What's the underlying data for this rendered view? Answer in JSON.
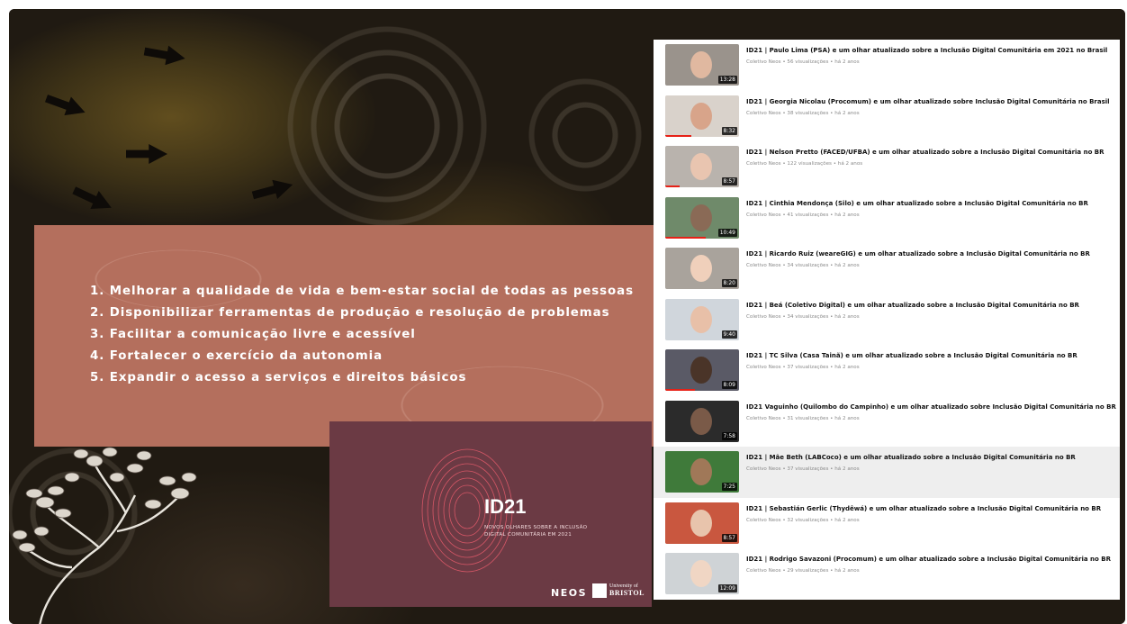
{
  "goals": [
    "1. Melhorar a qualidade de vida e bem-estar social de todas as pessoas",
    "2. Disponibilizar ferramentas de produção e resolução de problemas",
    "3. Facilitar a comunicação livre e acessível",
    "4. Fortalecer o exercício da autonomia",
    "5. Expandir o acesso a serviços e direitos básicos"
  ],
  "card": {
    "title": "ID21",
    "subtitle": "NOVOS OLHARES SOBRE A INCLUSÃO DIGITAL COMUNITÁRIA EM 2021",
    "neos": "NEOS",
    "bristol_small": "University of",
    "bristol_big": "BRISTOL"
  },
  "videos": [
    {
      "title": "ID21 | Paulo Lima (PSA) e um olhar atualizado sobre a Inclusão Digital Comunitária em 2021 no Brasil",
      "meta": "Coletivo Neos • 56 visualizações • há 2 anos",
      "duration": "13:28"
    },
    {
      "title": "ID21 | Georgia Nicolau (Procomum) e um olhar atualizado sobre Inclusão Digital Comunitária no Brasil",
      "meta": "Coletivo Neos • 38 visualizações • há 2 anos",
      "duration": "8:32"
    },
    {
      "title": "ID21 | Nelson Pretto (FACED/UFBA) e um olhar atualizado sobre a Inclusão Digital Comunitária no BR",
      "meta": "Coletivo Neos • 122 visualizações • há 2 anos",
      "duration": "8:57"
    },
    {
      "title": "ID21 | Cinthia Mendonça (Silo) e um olhar atualizado sobre a Inclusão Digital Comunitária no BR",
      "meta": "Coletivo Neos • 41 visualizações • há 2 anos",
      "duration": "10:49"
    },
    {
      "title": "ID21 | Ricardo Ruiz (weareGIG) e um olhar atualizado sobre a Inclusão Digital Comunitária no BR",
      "meta": "Coletivo Neos • 34 visualizações • há 2 anos",
      "duration": "8:20"
    },
    {
      "title": "ID21 | Beá (Coletivo Digital) e um olhar atualizado sobre a Inclusão Digital Comunitária no BR",
      "meta": "Coletivo Neos • 34 visualizações • há 2 anos",
      "duration": "9:40"
    },
    {
      "title": "ID21 | TC Silva (Casa Tainã) e um olhar atualizado sobre a Inclusão Digital Comunitária no BR",
      "meta": "Coletivo Neos • 37 visualizações • há 2 anos",
      "duration": "8:09"
    },
    {
      "title": "ID21 Vaguinho (Quilombo do Campinho) e um olhar atualizado sobre Inclusão Digital Comunitária no BR",
      "meta": "Coletivo Neos • 31 visualizações • há 2 anos",
      "duration": "7:58"
    },
    {
      "title": "ID21 | Mãe Beth (LABCoco) e um olhar atualizado sobre a Inclusão Digital Comunitária no BR",
      "meta": "Coletivo Neos • 37 visualizações • há 2 anos",
      "duration": "7:25"
    },
    {
      "title": "ID21 | Sebastián Gerlic (Thydêwá) e um olhar atualizado sobre a Inclusão Digital Comunitária no BR",
      "meta": "Coletivo Neos • 32 visualizações • há 2 anos",
      "duration": "8:57"
    },
    {
      "title": "ID21 | Rodrigo Savazoni (Procomum) e um olhar atualizado sobre a Inclusão Digital Comunitária no BR",
      "meta": "Coletivo Neos • 29 visualizações • há 2 anos",
      "duration": "12:09"
    }
  ],
  "thumb_colors": [
    "#9a938c",
    "#d9d2cb",
    "#b9b3ad",
    "#6f8a6a",
    "#a9a39c",
    "#d0d6dc",
    "#5a5a66",
    "#2b2b2b",
    "#3f7a3a",
    "#c9573f",
    "#cfd3d6"
  ],
  "face_colors": [
    "#e0b8a0",
    "#d8a48a",
    "#e9c5b0",
    "#8a6a56",
    "#f0d0bb",
    "#e8c0a8",
    "#4a3428",
    "#7a5a48",
    "#a07858",
    "#e8c4ac",
    "#f0d6c4"
  ]
}
